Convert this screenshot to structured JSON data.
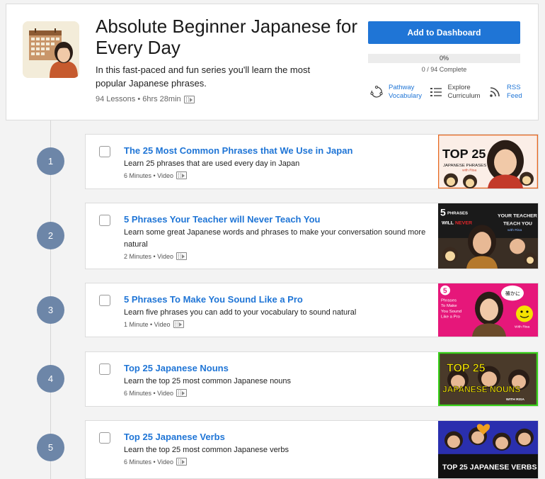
{
  "course": {
    "title": "Absolute Beginner Japanese for Every Day",
    "description": "In this fast-paced and fun series you'll learn the most popular Japanese phrases.",
    "meta": "94 Lessons • 6hrs 28min",
    "add_button": "Add to Dashboard",
    "progress_label": "0%",
    "progress_value": 0,
    "complete_text": "0 / 94 Complete"
  },
  "links": {
    "pathway": "Pathway Vocabulary",
    "curriculum": "Explore Curriculum",
    "rss": "RSS Feed"
  },
  "lessons": [
    {
      "number": "1",
      "title": "The 25 Most Common Phrases that We Use in Japan",
      "description": "Learn 25 phrases that are used every day in Japan",
      "meta": "6 Minutes • Video"
    },
    {
      "number": "2",
      "title": "5 Phrases Your Teacher will Never Teach You",
      "description": "Learn some great Japanese words and phrases to make your conversation sound more natural",
      "meta": "2 Minutes • Video"
    },
    {
      "number": "3",
      "title": "5 Phrases To Make You Sound Like a Pro",
      "description": "Learn five phrases you can add to your vocabulary to sound natural",
      "meta": "1 Minute • Video"
    },
    {
      "number": "4",
      "title": "Top 25 Japanese Nouns",
      "description": "Learn the top 25 most common Japanese nouns",
      "meta": "6 Minutes • Video"
    },
    {
      "number": "5",
      "title": "Top 25 Japanese Verbs",
      "description": "Learn the top 25 most common Japanese verbs",
      "meta": "6 Minutes • Video"
    }
  ],
  "thumb_text": {
    "t1_top": "TOP 25",
    "t1_sub": "JAPANESE PHRASES",
    "t1_with": "with Risa",
    "t2_num": "5",
    "t2_phrases": "PHRASES",
    "t2_will": "WILL",
    "t2_never": "NEVER",
    "t2_your": "YOUR TEACHER",
    "t2_teach": "TEACH YOU",
    "t2_with": "with Risa",
    "t3_num": "5",
    "t3_l1": "Phrases",
    "t3_l2": "To Make",
    "t3_l3": "You Sound",
    "t3_l4": "Like a Pro",
    "t3_jp": "確かに",
    "t3_with": "With Risa",
    "t4_l1": "TOP 25",
    "t4_l2": "JAPANESE NOUNS",
    "t4_with": "WITH RISA",
    "t5_text": "TOP 25 JAPANESE VERBS"
  },
  "colors": {
    "accent": "#1f75d6",
    "circle": "#6d86a8",
    "thumb3_bg": "#e6177a",
    "thumb4_border": "#39d11a",
    "thumb5_bg": "#2a2fae"
  }
}
